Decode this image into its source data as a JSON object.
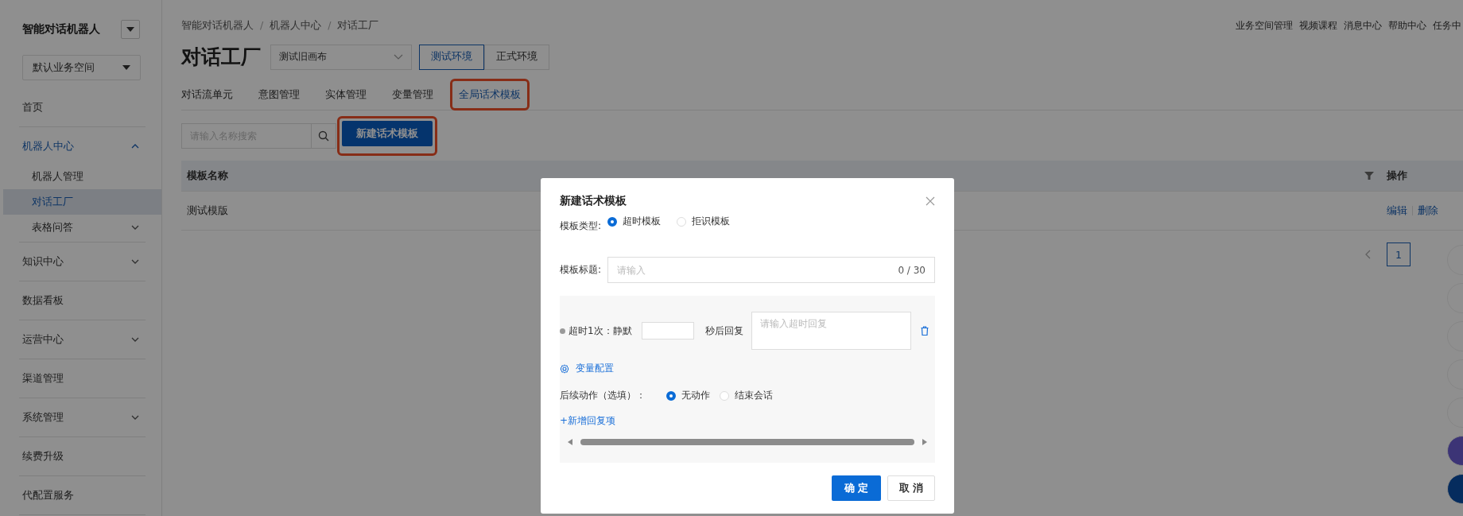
{
  "sidebar": {
    "app_title": "智能对话机器人",
    "workspace": "默认业务空间",
    "items": [
      {
        "label": "首页",
        "kind": "link",
        "selected": false
      },
      {
        "label": "机器人中心",
        "kind": "group",
        "selected": true,
        "expanded": true,
        "children": [
          {
            "label": "机器人管理",
            "kind": "link",
            "selected": false
          },
          {
            "label": "对话工厂",
            "kind": "link",
            "selected": true
          },
          {
            "label": "表格问答",
            "kind": "group",
            "selected": false,
            "expanded": false
          }
        ]
      },
      {
        "label": "知识中心",
        "kind": "group",
        "selected": false,
        "expanded": false
      },
      {
        "label": "数据看板",
        "kind": "link",
        "selected": false
      },
      {
        "label": "运营中心",
        "kind": "group",
        "selected": false,
        "expanded": false
      },
      {
        "label": "渠道管理",
        "kind": "link",
        "selected": false
      },
      {
        "label": "系统管理",
        "kind": "group",
        "selected": false,
        "expanded": false
      },
      {
        "label": "续费升级",
        "kind": "link",
        "selected": false
      },
      {
        "label": "代配置服务",
        "kind": "link",
        "selected": false
      }
    ]
  },
  "top_links": [
    "业务空间管理",
    "视频课程",
    "消息中心",
    "帮助中心",
    "任务中"
  ],
  "breadcrumb": [
    "智能对话机器人",
    "机器人中心",
    "对话工厂"
  ],
  "breadcrumb_separator": "/",
  "page_title": "对话工厂",
  "canvas_select": {
    "value": "测试旧画布"
  },
  "env_tabs": [
    {
      "label": "测试环境",
      "selected": true
    },
    {
      "label": "正式环境",
      "selected": false
    }
  ],
  "tabs": [
    {
      "label": "对话流单元",
      "selected": false,
      "highlighted": false
    },
    {
      "label": "意图管理",
      "selected": false,
      "highlighted": false
    },
    {
      "label": "实体管理",
      "selected": false,
      "highlighted": false
    },
    {
      "label": "变量管理",
      "selected": false,
      "highlighted": false
    },
    {
      "label": "全局话术模板",
      "selected": true,
      "highlighted": true
    }
  ],
  "search": {
    "placeholder": "请输入名称搜索"
  },
  "new_button": {
    "label": "新建话术模板",
    "highlighted": true
  },
  "table": {
    "columns": [
      "模板名称",
      "操作"
    ],
    "rows": [
      {
        "name": "测试模版",
        "actions": [
          "编辑",
          "删除"
        ]
      }
    ]
  },
  "pagination": [
    {
      "label": "1",
      "selected": true
    }
  ],
  "modal": {
    "title": "新建话术模板",
    "type_label": "模板类型:",
    "type_options": [
      {
        "label": "超时模板",
        "selected": true
      },
      {
        "label": "拒识模板",
        "selected": false
      }
    ],
    "title_label": "模板标题:",
    "title_field": {
      "placeholder": "请输入",
      "counter": "0 / 30"
    },
    "reply": {
      "label": "超时1次：静默",
      "suffix": "秒后回复",
      "placeholder": "请输入超时回复"
    },
    "var_config": "变量配置",
    "followup_label": "后续动作（选填）：",
    "followup_options": [
      {
        "label": "无动作",
        "selected": true
      },
      {
        "label": "结束会话",
        "selected": false
      }
    ],
    "add_reply": "+新增回复项",
    "buttons": [
      {
        "label": "确定",
        "kind": "primary"
      },
      {
        "label": "取消",
        "kind": "default"
      }
    ]
  }
}
